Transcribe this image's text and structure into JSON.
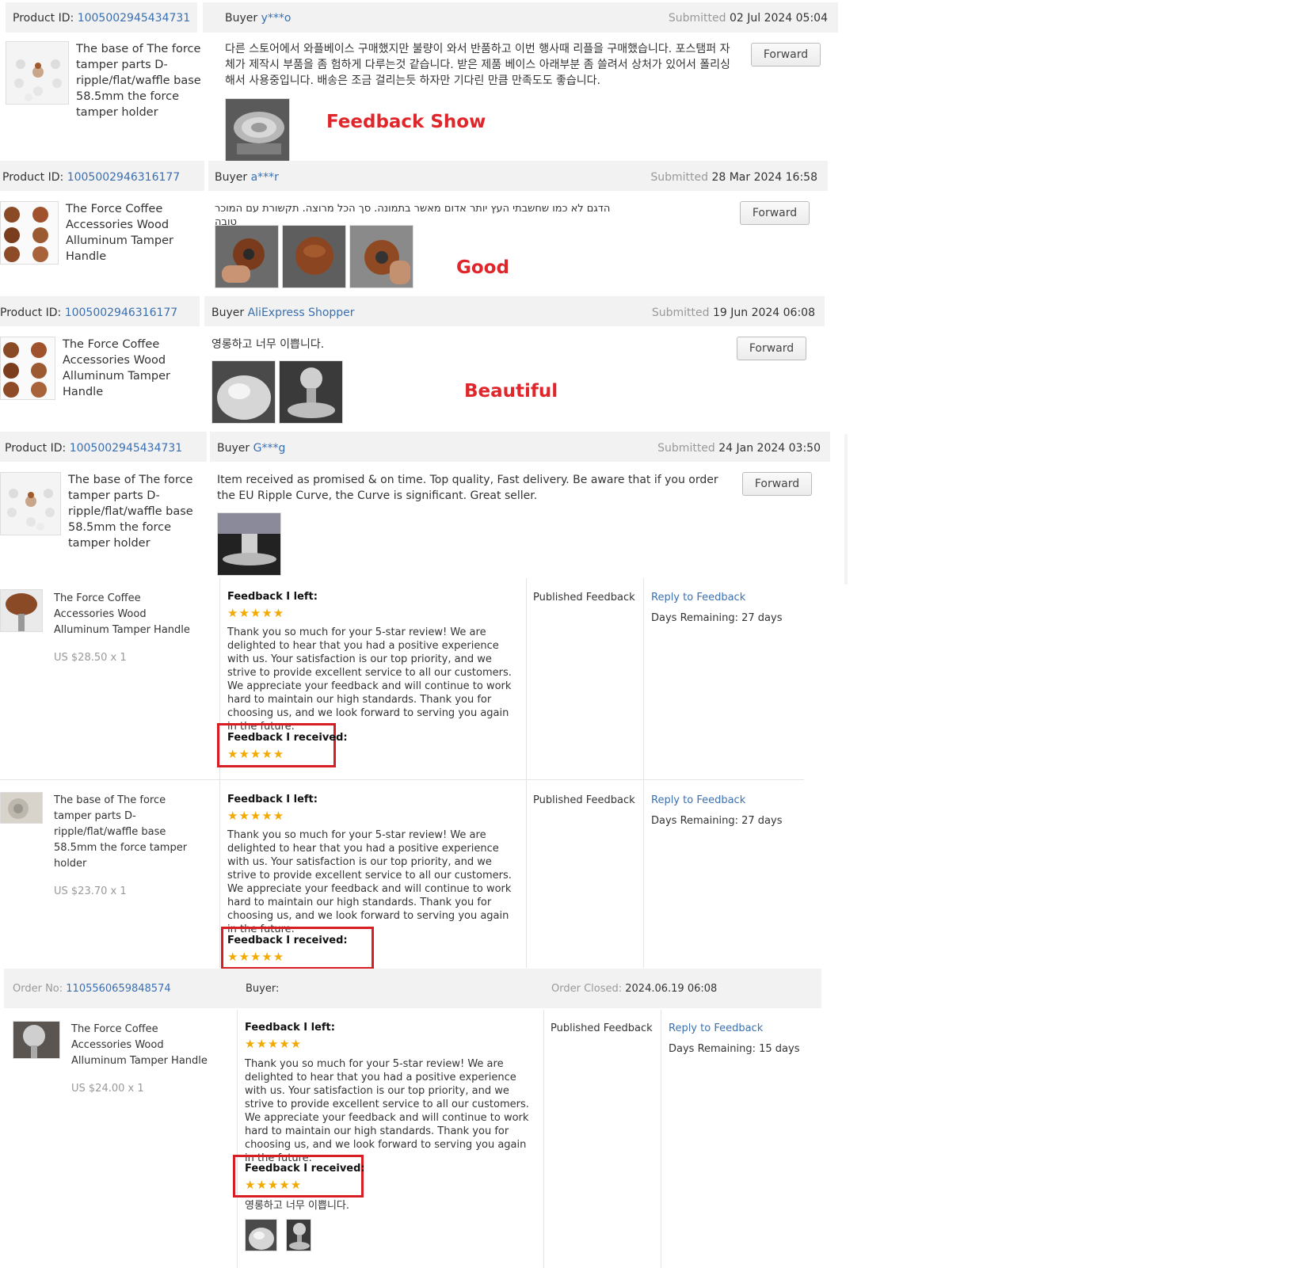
{
  "colors": {
    "accent_link": "#3a6fb0",
    "highlight_red": "#e0262a",
    "star": "#f2a900",
    "bar_bg": "#f2f2f2"
  },
  "labels": {
    "product_id": "Product ID:",
    "buyer": "Buyer",
    "submitted": "Submitted",
    "forward": "Forward",
    "feedback_left": "Feedback I left:",
    "feedback_received": "Feedback I received:",
    "published": "Published Feedback",
    "reply": "Reply to Feedback",
    "order_no": "Order No:",
    "buyer_colon": "Buyer:",
    "order_closed": "Order Closed:",
    "stars": "★★★★★"
  },
  "reviews": [
    {
      "product_id": "1005002945434731",
      "buyer": "y***o",
      "date": "02 Jul 2024 05:04",
      "title": "The base of The force tamper parts D-ripple/flat/waffle base 58.5mm the force tamper holder",
      "text": "다른 스토어에서 와플베이스 구매했지만 불량이 와서 반품하고 이번 행사때 리플을 구매했습니다. 포스탬퍼 자체가 제작시 부품을 좀 험하게 다루는것 같습니다. 받은 제품 베이스 아래부분 좀 쓸려서 상처가 있어서 폴리싱 해서 사용중입니다. 배송은 조금 걸리는듯 하자만 기다린 만큼 만족도도 좋습니다.",
      "annotation": "Feedback Show"
    },
    {
      "product_id": "1005002946316177",
      "buyer": "a***r",
      "date": "28 Mar 2024 16:58",
      "title": "The Force Coffee Accessories Wood Alluminum Tamper Handle",
      "text": "הדגם לא כמו שחשבתי העץ יותר אדום מאשר בתמונה. סך הכל מרוצה. תקשורת עם המוכר טובה",
      "annotation": "Good"
    },
    {
      "product_id": "1005002946316177",
      "buyer": "AliExpress Shopper",
      "date": "19 Jun 2024 06:08",
      "title": "The Force Coffee Accessories Wood Alluminum Tamper Handle",
      "text": "영롱하고 너무 이쁩니다.",
      "annotation": "Beautiful"
    },
    {
      "product_id": "1005002945434731",
      "buyer": "G***g",
      "date": "24 Jan 2024 03:50",
      "title": "The base of The force tamper parts D-ripple/flat/waffle base 58.5mm the force tamper holder",
      "text": "Item received as promised & on time. Top quality,  Fast delivery. Be aware that if you order the EU Ripple Curve, the Curve is significant. Great seller."
    }
  ],
  "feedback_rows": [
    {
      "title": "The Force Coffee Accessories Wood Alluminum Tamper Handle",
      "price": "US $28.50 x 1",
      "reply_text": "Thank you so much for your 5-star review! We are delighted to hear that you had a positive experience with us. Your satisfaction is our top priority, and we strive to provide excellent service to all our customers. We appreciate your feedback and will continue to work hard to maintain our high standards. Thank you for choosing us, and we look forward to serving you again in the future.",
      "days": "Days Remaining: 27 days"
    },
    {
      "title": "The base of The force tamper parts D-ripple/flat/waffle base 58.5mm the force tamper holder",
      "price": "US $23.70 x 1",
      "reply_text": "Thank you so much for your 5-star review! We are delighted to hear that you had a positive experience with us. Your satisfaction is our top priority, and we strive to provide excellent service to all our customers. We appreciate your feedback and will continue to work hard to maintain our high standards. Thank you for choosing us, and we look forward to serving you again in the future.",
      "days": "Days Remaining: 27 days"
    }
  ],
  "order": {
    "order_no": "1105560659848574",
    "closed": "2024.06.19 06:08",
    "title": "The Force Coffee Accessories Wood Alluminum Tamper Handle",
    "price": "US $24.00 x 1",
    "reply_text": "Thank you so much for your 5-star review! We are delighted to hear that you had a positive experience with us. Your satisfaction is our top priority, and we strive to provide excellent service to all our customers. We appreciate your feedback and will continue to work hard to maintain our high standards. Thank you for choosing us, and we look forward to serving you again in the future.",
    "received_text": "영롱하고 너무 이쁩니다.",
    "days": "Days Remaining: 15 days"
  }
}
